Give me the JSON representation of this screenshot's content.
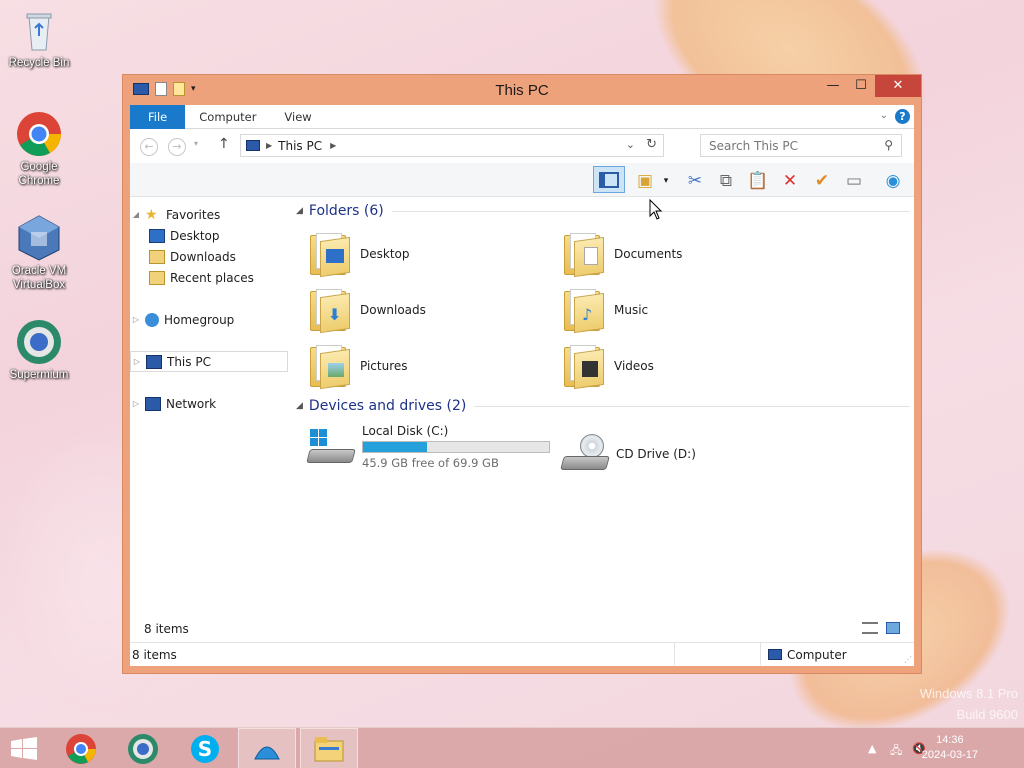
{
  "desktop": {
    "icons": [
      {
        "label": "Recycle Bin"
      },
      {
        "label": "Google Chrome"
      },
      {
        "label": "Oracle VM VirtualBox"
      },
      {
        "label": "Supermium"
      }
    ],
    "watermark_line1": "Windows 8.1 Pro",
    "watermark_line2": "Build 9600"
  },
  "window": {
    "title": "This PC",
    "ribbon_tabs": [
      "File",
      "Computer",
      "View"
    ],
    "address_crumb": "This PC",
    "search_placeholder": "Search This PC",
    "nav": {
      "favorites": "Favorites",
      "desktop": "Desktop",
      "downloads": "Downloads",
      "recent": "Recent places",
      "homegroup": "Homegroup",
      "this_pc": "This PC",
      "network": "Network"
    },
    "folders_header": "Folders (6)",
    "folders": [
      "Desktop",
      "Documents",
      "Downloads",
      "Music",
      "Pictures",
      "Videos"
    ],
    "devices_header": "Devices and drives (2)",
    "drive_c": {
      "name": "Local Disk (C:)",
      "free_text": "45.9 GB free of 69.9 GB",
      "used_fraction": 0.343
    },
    "drive_d": {
      "name": "CD Drive (D:)"
    },
    "inner_status": "8 items",
    "status_left": "8 items",
    "status_right": "Computer"
  },
  "taskbar": {
    "time": "14:36",
    "date": "2024-03-17"
  },
  "colors": {
    "accent": "#1979ca",
    "window_frame": "#eea27b",
    "close": "#c7463c",
    "bar_fill": "#26a0da"
  }
}
